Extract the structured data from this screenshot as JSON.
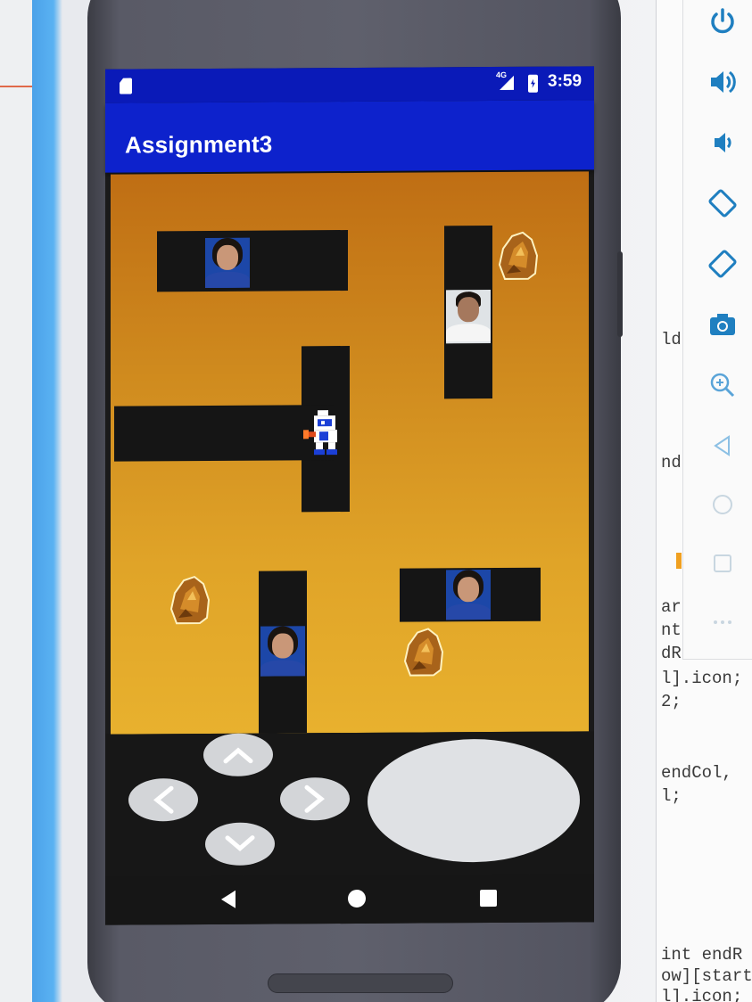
{
  "app": {
    "title": "Assignment3"
  },
  "status_bar": {
    "network": "4G",
    "time": "3:59"
  },
  "editor_code": {
    "lines": [
      {
        "text": "ld"
      },
      {
        "text": "nd"
      },
      {
        "text": "ar"
      },
      {
        "text": "nt"
      },
      {
        "text": "dR"
      },
      {
        "text": "l].icon;"
      },
      {
        "text": "2;"
      },
      {
        "text": "endCol,"
      },
      {
        "text": "l;"
      },
      {
        "text": "int endR"
      },
      {
        "text": "ow][start"
      },
      {
        "text": "l].icon;"
      }
    ]
  },
  "emulator_toolbar": {
    "buttons": [
      "power-icon",
      "volume-up-icon",
      "volume-down-icon",
      "rotate-left-icon",
      "rotate-right-icon",
      "camera-icon",
      "zoom-icon",
      "back-icon",
      "home-icon",
      "overview-icon",
      "more-icon"
    ]
  },
  "game": {
    "player": "digger-player",
    "enemies": [
      "face-enemy-woman",
      "face-enemy-man",
      "face-enemy-woman",
      "face-enemy-woman"
    ],
    "rocks": 3
  },
  "controls": {
    "dpad": [
      "up",
      "left",
      "right",
      "down"
    ],
    "action": "fire"
  },
  "colors": {
    "status_bar": "#0a1ab8",
    "app_bar": "#0d22cc",
    "dirt_top": "#bf6e14",
    "dirt_bottom": "#e8b12e",
    "tunnel": "#151515",
    "toolbar_icon": "#1f7fc0"
  }
}
